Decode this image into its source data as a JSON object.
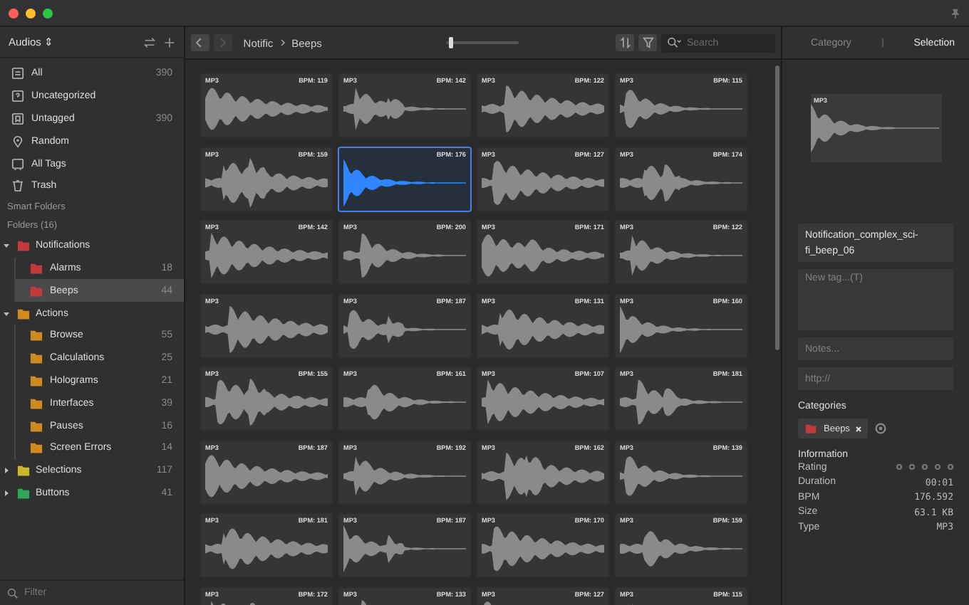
{
  "sidebar": {
    "library": "Audios ⇕",
    "items": [
      {
        "label": "All",
        "count": "390",
        "kind": "all"
      },
      {
        "label": "Uncategorized",
        "kind": "uncategorized"
      },
      {
        "label": "Untagged",
        "count": "390",
        "kind": "untagged"
      },
      {
        "label": "Random",
        "kind": "random"
      },
      {
        "label": "All Tags",
        "kind": "tags"
      },
      {
        "label": "Trash",
        "kind": "trash"
      }
    ],
    "smart_folders": "Smart Folders",
    "folders_heading": "Folders (16)",
    "folders": [
      {
        "label": "Notifications",
        "color": "#c0393b",
        "expanded": true,
        "selected": false,
        "children": [
          {
            "label": "Alarms",
            "count": "18",
            "color": "#c0393b",
            "selected": false
          },
          {
            "label": "Beeps",
            "count": "44",
            "color": "#c0393b",
            "selected": true
          }
        ]
      },
      {
        "label": "Actions",
        "color": "#d08a1e",
        "expanded": true,
        "selected": false,
        "children": [
          {
            "label": "Browse",
            "count": "55",
            "color": "#d08a1e",
            "selected": false
          },
          {
            "label": "Calculations",
            "count": "25",
            "color": "#d08a1e",
            "selected": false
          },
          {
            "label": "Holograms",
            "count": "21",
            "color": "#d08a1e",
            "selected": false
          },
          {
            "label": "Interfaces",
            "count": "39",
            "color": "#d08a1e",
            "selected": false
          },
          {
            "label": "Pauses",
            "count": "16",
            "color": "#d08a1e",
            "selected": false
          },
          {
            "label": "Screen Errors",
            "count": "14",
            "color": "#d08a1e",
            "selected": false
          }
        ]
      },
      {
        "label": "Selections",
        "count": "117",
        "color": "#c9b92a",
        "expanded": false,
        "selected": false
      },
      {
        "label": "Buttons",
        "count": "41",
        "color": "#2fa75a",
        "expanded": false,
        "selected": false
      }
    ],
    "filter": {
      "placeholder": "Filter"
    }
  },
  "toolbar": {
    "breadcrumb": [
      "Notific",
      "Beeps"
    ],
    "zoom": {
      "level": 0.07
    },
    "search": {
      "placeholder": "Search"
    }
  },
  "cards": [
    {
      "format": "MP3",
      "bpm": "BPM: 119",
      "selected": false
    },
    {
      "format": "MP3",
      "bpm": "BPM: 142",
      "selected": false
    },
    {
      "format": "MP3",
      "bpm": "BPM: 122",
      "selected": false
    },
    {
      "format": "MP3",
      "bpm": "BPM: 115",
      "selected": false
    },
    {
      "format": "MP3",
      "bpm": "BPM: 159",
      "selected": false
    },
    {
      "bpm": "BPM: 176",
      "selected": true
    },
    {
      "format": "MP3",
      "bpm": "BPM: 127",
      "selected": false
    },
    {
      "format": "MP3",
      "bpm": "BPM: 174",
      "selected": false
    },
    {
      "format": "MP3",
      "bpm": "BPM: 142",
      "selected": false
    },
    {
      "format": "MP3",
      "bpm": "BPM: 200",
      "selected": false
    },
    {
      "format": "MP3",
      "bpm": "BPM: 171",
      "selected": false
    },
    {
      "format": "MP3",
      "bpm": "BPM: 122",
      "selected": false
    },
    {
      "format": "MP3",
      "selected": false
    },
    {
      "format": "MP3",
      "bpm": "BPM: 187",
      "selected": false
    },
    {
      "format": "MP3",
      "bpm": "BPM: 131",
      "selected": false
    },
    {
      "format": "MP3",
      "bpm": "BPM: 160",
      "selected": false
    },
    {
      "format": "MP3",
      "bpm": "BPM: 155",
      "selected": false
    },
    {
      "format": "MP3",
      "bpm": "BPM: 161",
      "selected": false
    },
    {
      "format": "MP3",
      "bpm": "BPM: 107",
      "selected": false
    },
    {
      "format": "MP3",
      "bpm": "BPM: 181",
      "selected": false
    },
    {
      "format": "MP3",
      "bpm": "BPM: 187",
      "selected": false
    },
    {
      "format": "MP3",
      "bpm": "BPM: 192",
      "selected": false
    },
    {
      "format": "MP3",
      "bpm": "BPM: 162",
      "selected": false
    },
    {
      "format": "MP3",
      "bpm": "BPM: 139",
      "selected": false
    },
    {
      "format": "MP3",
      "bpm": "BPM: 181",
      "selected": false
    },
    {
      "format": "MP3",
      "bpm": "BPM: 187",
      "selected": false
    },
    {
      "format": "MP3",
      "bpm": "BPM: 170",
      "selected": false
    },
    {
      "format": "MP3",
      "bpm": "BPM: 159",
      "selected": false
    },
    {
      "format": "MP3",
      "bpm": "BPM: 172",
      "selected": false
    },
    {
      "format": "MP3",
      "bpm": "BPM: 133",
      "selected": false
    },
    {
      "format": "MP3",
      "bpm": "BPM: 127",
      "selected": false
    },
    {
      "format": "MP3",
      "bpm": "BPM: 115",
      "selected": false
    }
  ],
  "inspector": {
    "tabs": [
      {
        "label": "Category",
        "selected": false
      },
      {
        "label": "Selection",
        "selected": true
      }
    ],
    "preview_format": "MP3",
    "name": "Notification_complex_sci-fi_beep_06",
    "tag_field": {
      "placeholder": "New tag...(T)"
    },
    "notes": {
      "placeholder": "Notes..."
    },
    "url": {
      "placeholder": "http://"
    },
    "categories_heading": "Categories",
    "categories": [
      {
        "label": "Beeps",
        "color": "#c0393b"
      }
    ],
    "information_heading": "Information",
    "information": [
      {
        "kind": "stars",
        "label": "Rating",
        "stars": 0
      },
      {
        "kind": "text",
        "label": "Duration",
        "value": "00:01"
      },
      {
        "kind": "text",
        "label": "BPM",
        "value": "176.592"
      },
      {
        "kind": "text",
        "label": "Size",
        "value": "63.1 KB"
      },
      {
        "kind": "text",
        "label": "Type",
        "value": "MP3"
      }
    ]
  }
}
